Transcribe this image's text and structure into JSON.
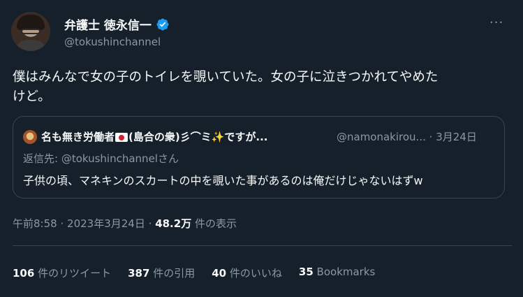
{
  "author": {
    "name": "弁護士 徳永信一",
    "handle": "@tokushinchannel"
  },
  "tweet": {
    "text_line1": "僕はみんなで女の子のトイレを覗いていた。女の子に泣きつかれてやめた",
    "text_line2": "けど。"
  },
  "quote": {
    "name_part1": "名も無き労働者",
    "name_part2": "(島合の衆)彡⌒ミ✨ですが...",
    "handle": "@namonakirou...",
    "sep": "·",
    "date": "3月24日",
    "reply_to": "返信先: @tokushinchannelさん",
    "text": "子供の頃、マネキンのスカートの中を覗いた事があるのは俺だけじゃないはずw"
  },
  "meta": {
    "time": "午前8:58",
    "sep1": "·",
    "date": "2023年3月24日",
    "sep2": "·",
    "views_count": "48.2万",
    "views_label": "件の表示"
  },
  "stats": {
    "retweets_count": "106",
    "retweets_label": "件のリツイート",
    "quotes_count": "387",
    "quotes_label": "件の引用",
    "likes_count": "40",
    "likes_label": "件のいいね",
    "bookmarks_count": "35",
    "bookmarks_label": "Bookmarks"
  },
  "more_glyph": "···",
  "colors": {
    "background": "#15202b",
    "text": "#f7f9f9",
    "secondary": "#8b98a5",
    "border": "#38444d",
    "verified": "#1d9bf0"
  }
}
